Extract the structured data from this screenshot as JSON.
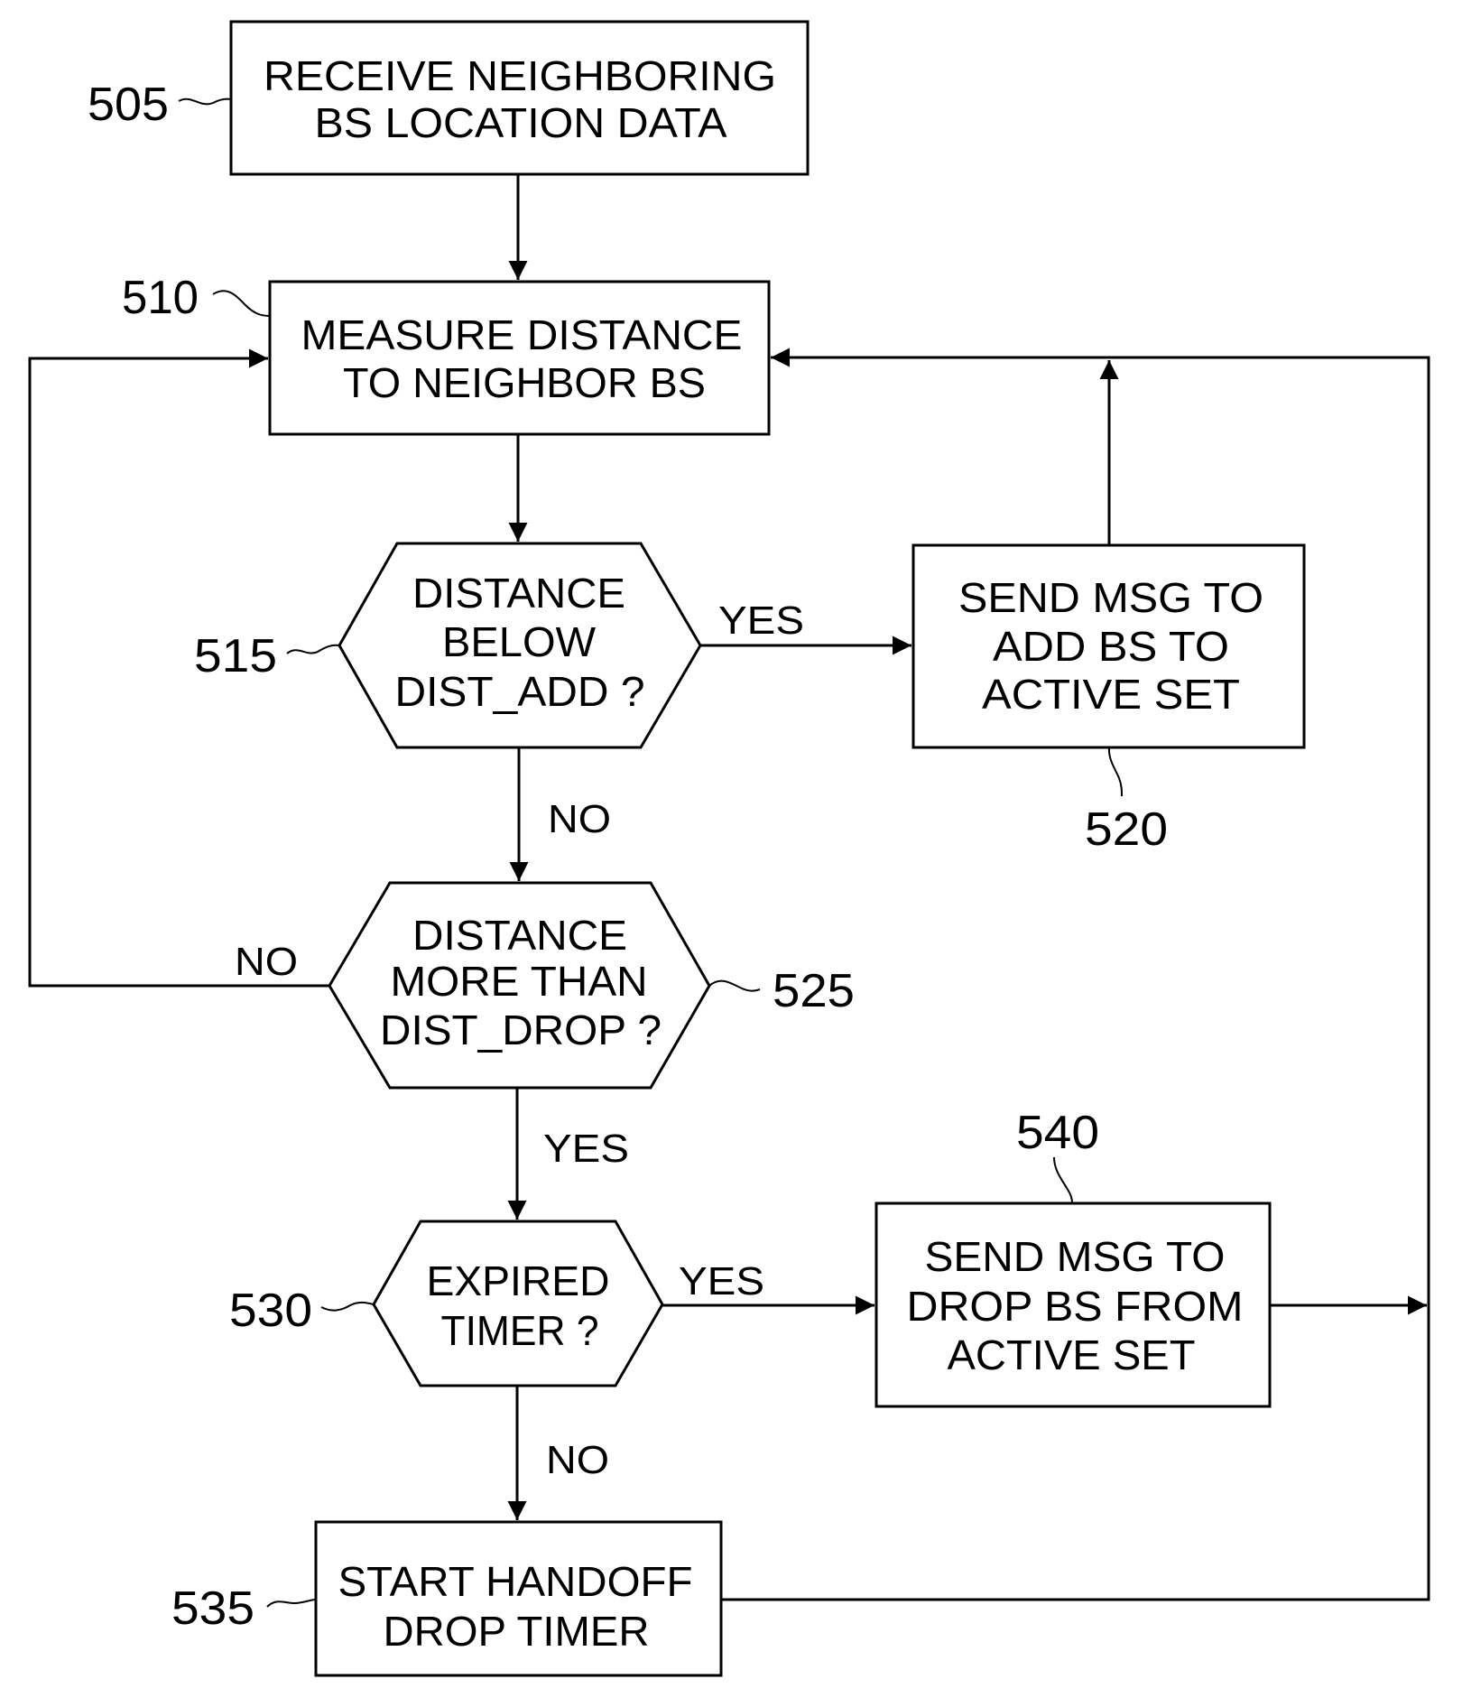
{
  "diagram": {
    "type": "flowchart",
    "nodes": {
      "n505": {
        "ref": "505",
        "shape": "process",
        "lines": [
          "RECEIVE NEIGHBORING",
          "BS LOCATION DATA"
        ]
      },
      "n510": {
        "ref": "510",
        "shape": "process",
        "lines": [
          "MEASURE DISTANCE",
          "TO NEIGHBOR BS"
        ]
      },
      "n515": {
        "ref": "515",
        "shape": "decision",
        "lines": [
          "DISTANCE",
          "BELOW",
          "DIST_ADD ?"
        ]
      },
      "n520": {
        "ref": "520",
        "shape": "process",
        "lines": [
          "SEND MSG TO",
          "ADD BS TO",
          "ACTIVE SET"
        ]
      },
      "n525": {
        "ref": "525",
        "shape": "decision",
        "lines": [
          "DISTANCE",
          "MORE THAN",
          "DIST_DROP ?"
        ]
      },
      "n530": {
        "ref": "530",
        "shape": "decision",
        "lines": [
          "EXPIRED",
          "TIMER ?"
        ]
      },
      "n540": {
        "ref": "540",
        "shape": "process",
        "lines": [
          "SEND MSG TO",
          "DROP BS FROM",
          "ACTIVE SET"
        ]
      },
      "n535": {
        "ref": "535",
        "shape": "process",
        "lines": [
          "START HANDOFF",
          "DROP TIMER"
        ]
      }
    },
    "edges": [
      {
        "from": "505",
        "to": "510",
        "label": ""
      },
      {
        "from": "510",
        "to": "515",
        "label": ""
      },
      {
        "from": "515",
        "to": "520",
        "label": "YES"
      },
      {
        "from": "515",
        "to": "525",
        "label": "NO"
      },
      {
        "from": "520",
        "to": "510",
        "label": ""
      },
      {
        "from": "525",
        "to": "510",
        "label": "NO"
      },
      {
        "from": "525",
        "to": "530",
        "label": "YES"
      },
      {
        "from": "530",
        "to": "540",
        "label": "YES"
      },
      {
        "from": "530",
        "to": "535",
        "label": "NO"
      },
      {
        "from": "540",
        "to": "510",
        "label": ""
      },
      {
        "from": "535",
        "to": "510",
        "label": ""
      }
    ],
    "edge_labels": {
      "yes_515": "YES",
      "no_515": "NO",
      "no_525": "NO",
      "yes_525": "YES",
      "yes_530": "YES",
      "no_530": "NO"
    }
  }
}
